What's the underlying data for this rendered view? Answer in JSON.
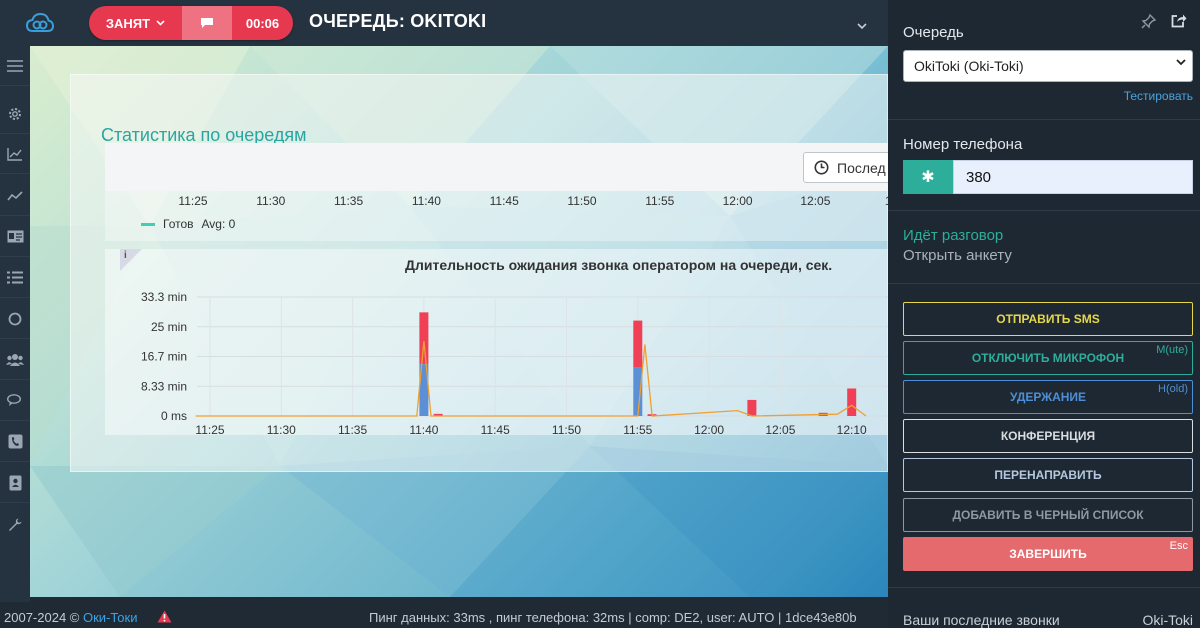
{
  "header": {
    "status_label": "ЗАНЯТ",
    "timer": "00:06",
    "title": "ОЧЕРЕДЬ: OKITOKI"
  },
  "nav": {
    "icons": [
      "menu-icon",
      "gear-icon",
      "chart-line-icon",
      "trend-icon",
      "id-card-icon",
      "list-icon",
      "circle-icon",
      "users-icon",
      "chat-icon",
      "phone-icon",
      "contacts-icon",
      "wrench-icon"
    ]
  },
  "main": {
    "card_title": "Статистика по очередям",
    "period_button": "Послед",
    "chart1": {
      "ticks": [
        "11:25",
        "11:30",
        "11:35",
        "11:40",
        "11:45",
        "11:50",
        "11:55",
        "12:00",
        "12:05",
        "12:"
      ],
      "legend_label": "Готов",
      "legend_avg": "Avg: 0"
    },
    "chart2_info": "i"
  },
  "chart_data": {
    "type": "bar",
    "title": "Длительность ожидания звонка оператором на очереди, сек.",
    "y_ticks": [
      "33.3 min",
      "25 min",
      "16.7 min",
      "8.33 min",
      "0 ms"
    ],
    "ylim": [
      0,
      33.3
    ],
    "x_ticks": [
      "11:25",
      "11:30",
      "11:35",
      "11:40",
      "11:45",
      "11:50",
      "11:55",
      "12:00",
      "12:05",
      "12:10"
    ],
    "series": [
      {
        "color": "#5b8fd6",
        "points": [
          {
            "x": "11:40",
            "y": 14.5
          },
          {
            "x": "11:55",
            "y": 13.7
          }
        ]
      },
      {
        "color": "#ef4056",
        "points": [
          {
            "x": "11:40",
            "y": 14.5
          },
          {
            "x": "11:41",
            "y": 0.6
          },
          {
            "x": "11:55",
            "y": 13.0
          },
          {
            "x": "11:56",
            "y": 0.5
          },
          {
            "x": "12:03",
            "y": 4.5
          },
          {
            "x": "12:08",
            "y": 0.9
          },
          {
            "x": "12:10",
            "y": 7.7
          }
        ]
      },
      {
        "color": "#f0a030",
        "type": "line",
        "points": [
          {
            "x": "11:24",
            "y": 0
          },
          {
            "x": "11:39.5",
            "y": 0
          },
          {
            "x": "11:40",
            "y": 21
          },
          {
            "x": "11:40.5",
            "y": 0
          },
          {
            "x": "11:55",
            "y": 0
          },
          {
            "x": "11:55.5",
            "y": 20
          },
          {
            "x": "11:56",
            "y": 0
          },
          {
            "x": "12:02",
            "y": 1.5
          },
          {
            "x": "12:03",
            "y": 0
          },
          {
            "x": "12:09",
            "y": 0.5
          },
          {
            "x": "12:10",
            "y": 3
          },
          {
            "x": "12:11",
            "y": 0
          }
        ]
      }
    ],
    "grid": true
  },
  "footer": {
    "copyright": "2007-2024 ©",
    "company_link": "Оки-Токи",
    "ping": "Пинг данных: 33ms , пинг телефона: 32ms | comp: DE2, user: AUTO | 1dce43e80b"
  },
  "right_panel": {
    "queue_label": "Очередь",
    "queue_value": "OkiToki (Oki-Toki)",
    "test_link": "Тестировать",
    "phone_label": "Номер телефона",
    "phone_key": "✱",
    "phone_value": "380",
    "talk_status": "Идёт разговор",
    "open_survey": "Открыть анкету",
    "buttons": [
      {
        "label": "ОТПРАВИТЬ SMS",
        "hotkey": "",
        "color": "#e6d84a"
      },
      {
        "label": "ОТКЛЮЧИТЬ МИКРОФОН",
        "hotkey": "M(ute)",
        "color": "#2cae9a"
      },
      {
        "label": "УДЕРЖАНИЕ",
        "hotkey": "H(old)",
        "color": "#4d8fd6"
      },
      {
        "label": "КОНФЕРЕНЦИЯ",
        "hotkey": "",
        "color": "#d9dee3"
      },
      {
        "label": "ПЕРЕНАПРАВИТЬ",
        "hotkey": "",
        "color": "#b5c8df"
      },
      {
        "label": "ДОБАВИТЬ В ЧЕРНЫЙ СПИСОК",
        "hotkey": "",
        "color": "#8d98a3"
      }
    ],
    "finish_label": "ЗАВЕРШИТЬ",
    "finish_hotkey": "Esc",
    "recent_calls": "Ваши последние звонки",
    "recent_right": "Oki-Toki"
  }
}
